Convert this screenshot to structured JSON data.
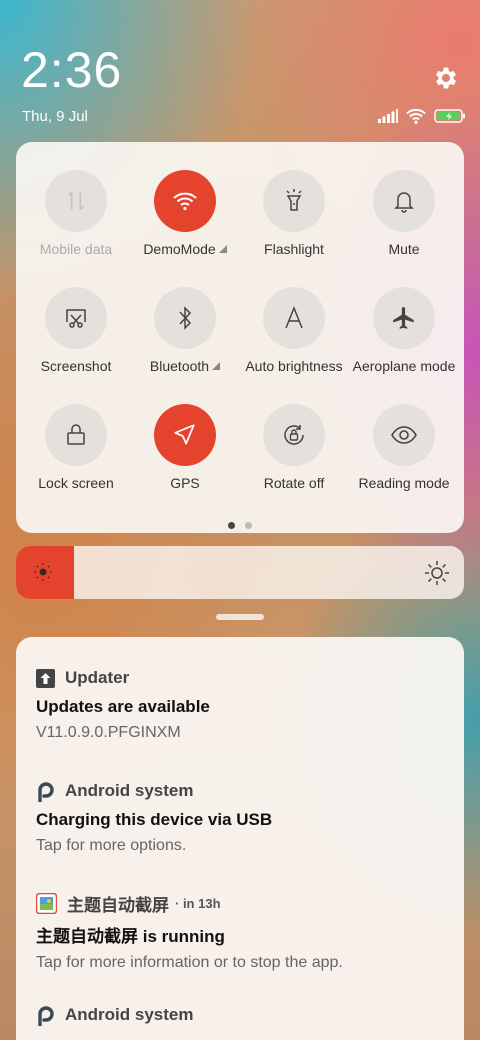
{
  "status": {
    "time": "2:36",
    "date": "Thu, 9 Jul",
    "icons": [
      "signal-icon",
      "wifi-icon",
      "battery-charging-icon"
    ]
  },
  "quick_settings": {
    "tiles": [
      {
        "label": "Mobile data",
        "icon": "mobile-data-icon",
        "active": false,
        "disabled": true,
        "expand": false
      },
      {
        "label": "DemoMode",
        "icon": "wifi-icon",
        "active": true,
        "disabled": false,
        "expand": true
      },
      {
        "label": "Flashlight",
        "icon": "flashlight-icon",
        "active": false,
        "disabled": false,
        "expand": false
      },
      {
        "label": "Mute",
        "icon": "bell-icon",
        "active": false,
        "disabled": false,
        "expand": false
      },
      {
        "label": "Screenshot",
        "icon": "screenshot-icon",
        "active": false,
        "disabled": false,
        "expand": false
      },
      {
        "label": "Bluetooth",
        "icon": "bluetooth-icon",
        "active": false,
        "disabled": false,
        "expand": true
      },
      {
        "label": "Auto brightness",
        "icon": "auto-brightness-icon",
        "active": false,
        "disabled": false,
        "expand": false
      },
      {
        "label": "Aeroplane mode",
        "icon": "airplane-icon",
        "active": false,
        "disabled": false,
        "expand": false
      },
      {
        "label": "Lock screen",
        "icon": "lock-icon",
        "active": false,
        "disabled": false,
        "expand": false
      },
      {
        "label": "GPS",
        "icon": "location-icon",
        "active": true,
        "disabled": false,
        "expand": false
      },
      {
        "label": "Rotate off",
        "icon": "rotate-lock-icon",
        "active": false,
        "disabled": false,
        "expand": false
      },
      {
        "label": "Reading mode",
        "icon": "eye-icon",
        "active": false,
        "disabled": false,
        "expand": false
      }
    ],
    "page": 1,
    "page_count": 2
  },
  "brightness": {
    "level": 0.13,
    "accent": "#e4432d"
  },
  "notifications": [
    {
      "app": "Updater",
      "time": "",
      "icon": "updater-icon",
      "title": "Updates are available",
      "body": "V11.0.9.0.PFGINXM"
    },
    {
      "app": "Android system",
      "time": "",
      "icon": "android-system-icon",
      "title": "Charging this device via USB",
      "body": "Tap for more options."
    },
    {
      "app": "主题自动截屏",
      "time": "· in 13h",
      "icon": "theme-screenshot-app-icon",
      "title": "主题自动截屏 is running",
      "body": "Tap for more information or to stop the app."
    },
    {
      "app": "Android system",
      "time": "",
      "icon": "android-system-icon",
      "title": "",
      "body": ""
    }
  ]
}
